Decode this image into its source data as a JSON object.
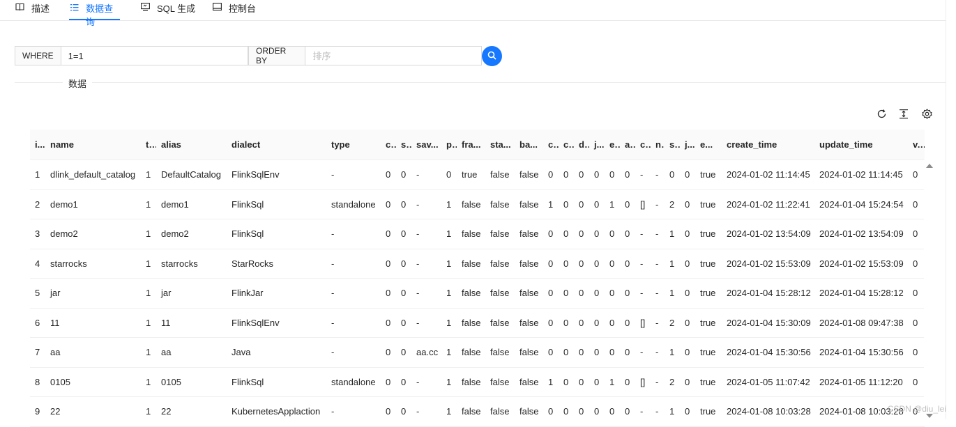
{
  "tabs": [
    {
      "label": "描述",
      "icon": "book-icon"
    },
    {
      "label": "数据查询",
      "icon": "list-icon"
    },
    {
      "label": "SQL 生成",
      "icon": "monitor-icon"
    },
    {
      "label": "控制台",
      "icon": "console-icon"
    }
  ],
  "query": {
    "where_label": "WHERE",
    "where_value": "1=1",
    "order_label": "ORDER BY",
    "order_placeholder": "排序"
  },
  "section_title": "数据",
  "columns": [
    "i...",
    "name",
    "t...",
    "alias",
    "dialect",
    "type",
    "c...",
    "s...",
    "sav...",
    "p...",
    "fra...",
    "sta...",
    "ba...",
    "c...",
    "c...",
    "d...",
    "j...",
    "e...",
    "a...",
    "c...",
    "n...",
    "s...",
    "j...",
    "e...",
    "create_time",
    "update_time",
    "v..."
  ],
  "rows": [
    [
      "1",
      "dlink_default_catalog",
      "1",
      "DefaultCatalog",
      "FlinkSqlEnv",
      "-",
      "0",
      "0",
      "-",
      "0",
      "true",
      "false",
      "false",
      "0",
      "0",
      "0",
      "0",
      "0",
      "0",
      "-",
      "-",
      "0",
      "0",
      "true",
      "2024-01-02 11:14:45",
      "2024-01-02 11:14:45",
      "0"
    ],
    [
      "2",
      "demo1",
      "1",
      "demo1",
      "FlinkSql",
      "standalone",
      "0",
      "0",
      "-",
      "1",
      "false",
      "false",
      "false",
      "1",
      "0",
      "0",
      "0",
      "1",
      "0",
      "[]",
      "-",
      "2",
      "0",
      "true",
      "2024-01-02 11:22:41",
      "2024-01-04 15:24:54",
      "0"
    ],
    [
      "3",
      "demo2",
      "1",
      "demo2",
      "FlinkSql",
      "-",
      "0",
      "0",
      "-",
      "1",
      "false",
      "false",
      "false",
      "0",
      "0",
      "0",
      "0",
      "0",
      "0",
      "-",
      "-",
      "1",
      "0",
      "true",
      "2024-01-02 13:54:09",
      "2024-01-02 13:54:09",
      "0"
    ],
    [
      "4",
      "starrocks",
      "1",
      "starrocks",
      "StarRocks",
      "-",
      "0",
      "0",
      "-",
      "1",
      "false",
      "false",
      "false",
      "0",
      "0",
      "0",
      "0",
      "0",
      "0",
      "-",
      "-",
      "1",
      "0",
      "true",
      "2024-01-02 15:53:09",
      "2024-01-02 15:53:09",
      "0"
    ],
    [
      "5",
      "jar",
      "1",
      "jar",
      "FlinkJar",
      "-",
      "0",
      "0",
      "-",
      "1",
      "false",
      "false",
      "false",
      "0",
      "0",
      "0",
      "0",
      "0",
      "0",
      "-",
      "-",
      "1",
      "0",
      "true",
      "2024-01-04 15:28:12",
      "2024-01-04 15:28:12",
      "0"
    ],
    [
      "6",
      "11",
      "1",
      "11",
      "FlinkSqlEnv",
      "-",
      "0",
      "0",
      "-",
      "1",
      "false",
      "false",
      "false",
      "0",
      "0",
      "0",
      "0",
      "0",
      "0",
      "[]",
      "-",
      "2",
      "0",
      "true",
      "2024-01-04 15:30:09",
      "2024-01-08 09:47:38",
      "0"
    ],
    [
      "7",
      "aa",
      "1",
      "aa",
      "Java",
      "-",
      "0",
      "0",
      "aa.cc",
      "1",
      "false",
      "false",
      "false",
      "0",
      "0",
      "0",
      "0",
      "0",
      "0",
      "-",
      "-",
      "1",
      "0",
      "true",
      "2024-01-04 15:30:56",
      "2024-01-04 15:30:56",
      "0"
    ],
    [
      "8",
      "0105",
      "1",
      "0105",
      "FlinkSql",
      "standalone",
      "0",
      "0",
      "-",
      "1",
      "false",
      "false",
      "false",
      "1",
      "0",
      "0",
      "0",
      "1",
      "0",
      "[]",
      "-",
      "2",
      "0",
      "true",
      "2024-01-05 11:07:42",
      "2024-01-05 11:12:20",
      "0"
    ],
    [
      "9",
      "22",
      "1",
      "22",
      "KubernetesApplaction",
      "-",
      "0",
      "0",
      "-",
      "1",
      "false",
      "false",
      "false",
      "0",
      "0",
      "0",
      "0",
      "0",
      "0",
      "-",
      "-",
      "1",
      "0",
      "true",
      "2024-01-08 10:03:28",
      "2024-01-08 10:03:28",
      "0"
    ]
  ],
  "toolbar": {
    "reload": "reload-icon",
    "density": "column-height-icon",
    "settings": "setting-icon"
  },
  "footnote": "CSDN @diu_lei"
}
